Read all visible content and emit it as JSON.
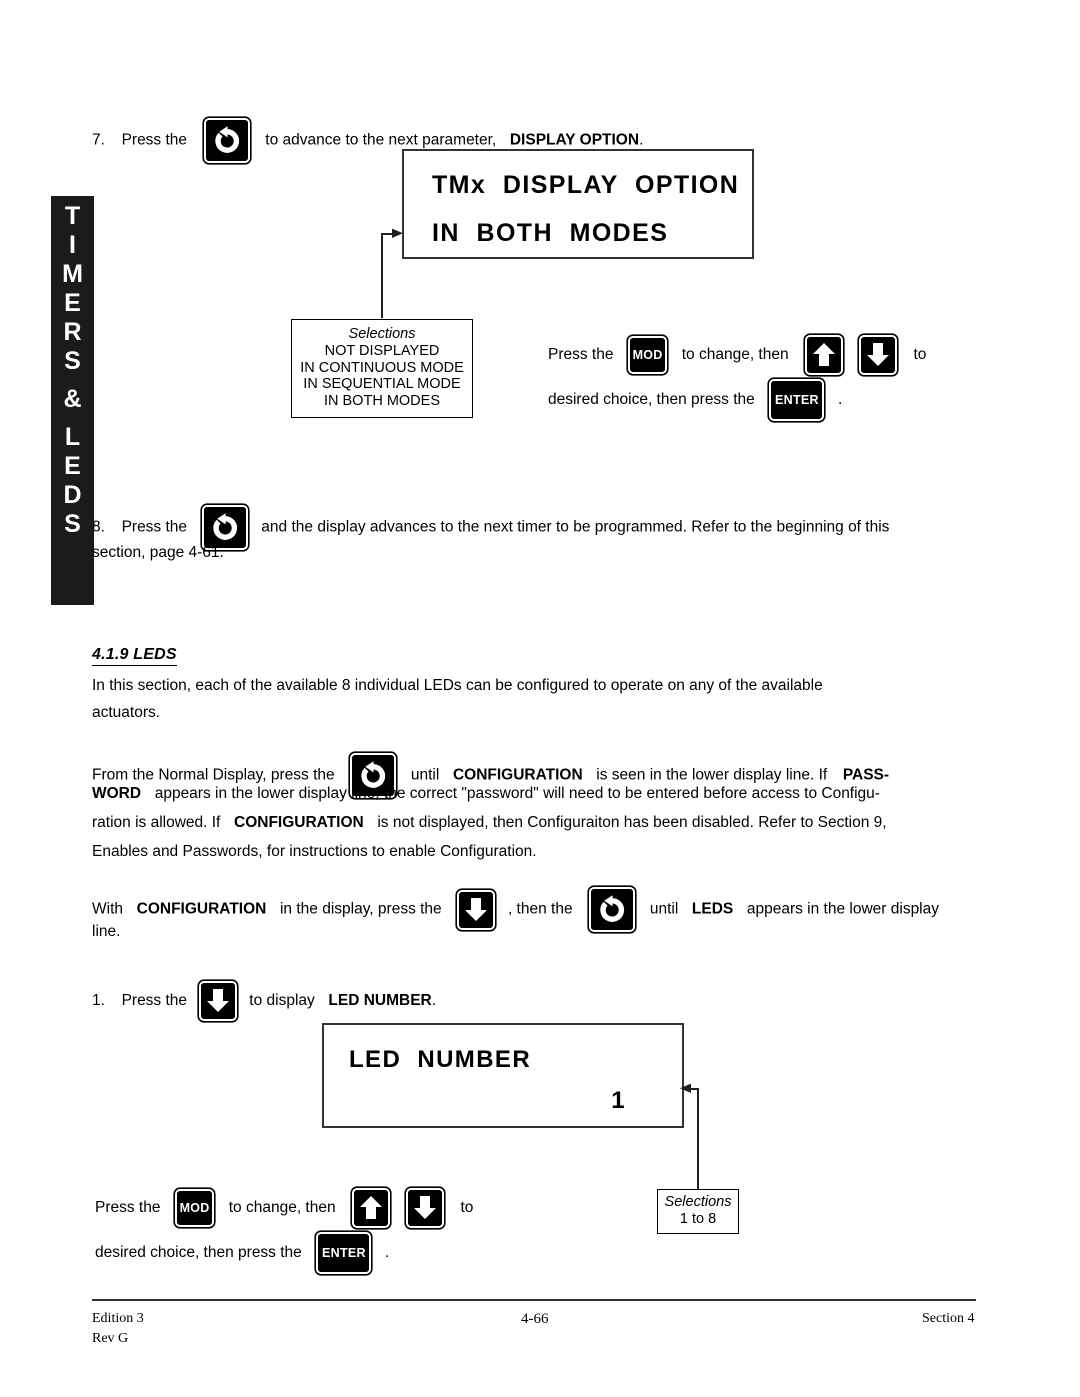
{
  "side_tab": {
    "name": "TIMERS & LEDS",
    "chars": [
      "T",
      "I",
      "M",
      "E",
      "R",
      "S",
      "&",
      "L",
      "E",
      "D",
      "S"
    ]
  },
  "step7": {
    "number": "7.",
    "text_before": "Press the",
    "text_after_a": "to advance to the next parameter,",
    "text_bold": "DISPLAY OPTION",
    "text_end": ".",
    "icon": "rotate-advance-icon"
  },
  "display_top": {
    "line1": "TMx  DISPLAY  OPTION",
    "line2": "IN  BOTH  MODES"
  },
  "selections_top": {
    "title": "Selections",
    "options": [
      "NOT DISPLAYED",
      "IN CONTINUOUS MODE",
      "IN SEQUENTIAL MODE",
      "IN BOTH MODES"
    ]
  },
  "instruction_top": {
    "l1_a": "Press the",
    "mod_label": "MOD",
    "l1_b": "to change, then",
    "l1_c": "to",
    "l2_a": "desired choice, then press the",
    "enter_label": "ENTER",
    "l2_b": "."
  },
  "step8": {
    "number": "8.",
    "text_before": "Press the",
    "text_after": "and the display advances to the next timer to be programmed.  Refer to the beginning of this",
    "line2": "section, page 4-61."
  },
  "section": {
    "heading": "4.1.9  LEDS",
    "para1_line1": "In this section, each of the available 8 individual LEDs can be configured to operate on any of the available",
    "para1_line2": "actuators.",
    "para2": {
      "l1_a": "From the Normal Display, press the",
      "l1_b": "until",
      "l1_bold1": "CONFIGURATION",
      "l1_c": "is seen in the lower display line.  If",
      "l1_bold2": "PASS-",
      "l2_bold": "WORD",
      "l2_text": "appears in the lower display line, the correct \"password\" will need to be entered before access to Configu-",
      "l3_a": "ration is allowed.  If",
      "l3_bold": "CONFIGURATION",
      "l3_b": "is not displayed, then Configuraiton has been disabled.  Refer to Section 9,",
      "l4": "Enables and Passwords, for instructions to enable Configuration."
    },
    "para3": {
      "l1_a": "With",
      "l1_bold1": "CONFIGURATION",
      "l1_b": "in the display, press the",
      "l1_c": ", then the",
      "l1_d": "until",
      "l1_bold2": "LEDS",
      "l1_e": "appears in the lower display",
      "l2": "line."
    }
  },
  "step1": {
    "number": "1.",
    "text_before": "Press the",
    "text_after": "to display",
    "text_bold": "LED NUMBER",
    "text_end": "."
  },
  "display_led": {
    "line1": "LED  NUMBER",
    "line2": "1"
  },
  "instruction_bottom": {
    "l1_a": "Press the",
    "mod_label": "MOD",
    "l1_b": "to change, then",
    "l1_c": "to",
    "l2_a": "desired choice, then press the",
    "enter_label": "ENTER",
    "l2_b": "."
  },
  "selections_bottom": {
    "title": "Selections",
    "range": "1 to 8"
  },
  "footer": {
    "edition": "Edition 3",
    "rev": "Rev G",
    "page": "4-66",
    "section": "Section 4"
  },
  "colors": {
    "ink": "#000000",
    "tab_bg": "#1b1b1b",
    "lcd_border": "#3a3030",
    "line": "#231f1f"
  }
}
